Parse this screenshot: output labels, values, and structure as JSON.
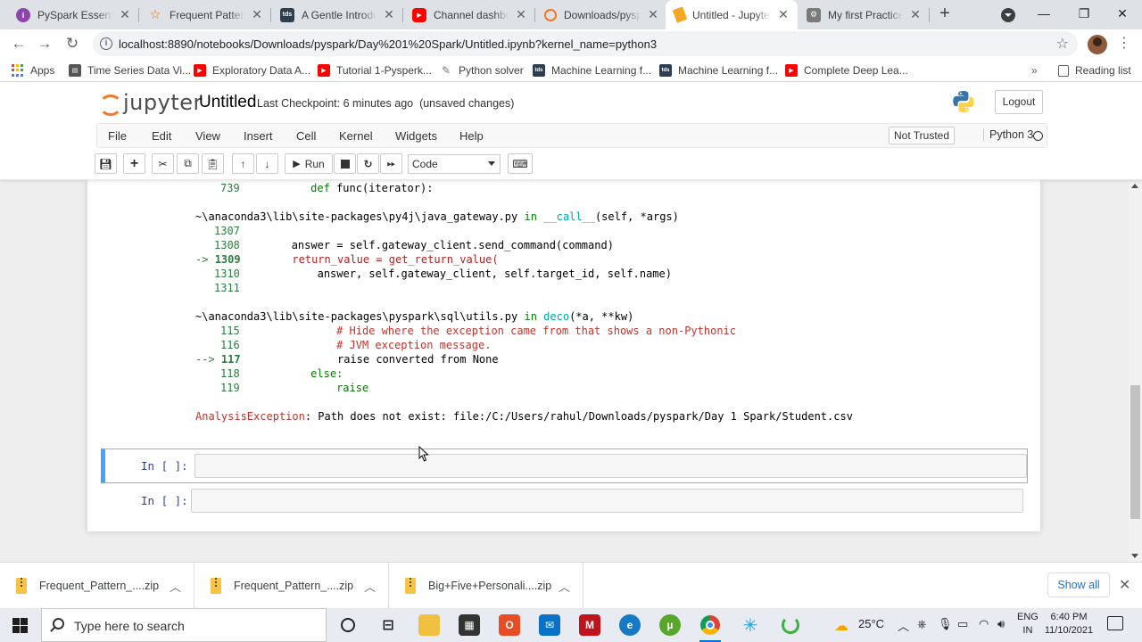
{
  "browser": {
    "tabs": [
      {
        "title": "PySpark Essentials",
        "icon": "pyspark-favicon",
        "color": "#8e44ad",
        "active": false
      },
      {
        "title": "Frequent Pattern Mining",
        "icon": "star-favicon",
        "color": "#e8710a",
        "active": false
      },
      {
        "title": "A Gentle Introduction",
        "icon": "tds-favicon",
        "color": "#2c3e50",
        "active": false
      },
      {
        "title": "Channel dashboard",
        "icon": "youtube-favicon",
        "color": "#ff0000",
        "active": false
      },
      {
        "title": "Downloads/pyspark",
        "icon": "jupyter-favicon",
        "color": "#f37726",
        "active": false
      },
      {
        "title": "Untitled - Jupyter",
        "icon": "jupyter-notebook-favicon",
        "color": "#f37726",
        "active": true
      },
      {
        "title": "My first Practice",
        "icon": "practice-favicon",
        "color": "#7b7b7b",
        "active": false
      }
    ],
    "url": "localhost:8890/notebooks/Downloads/pyspark/Day%201%20Spark/Untitled.ipynb?kernel_name=python3",
    "bookmarks": [
      {
        "label": "Apps",
        "icon": "apps-grid-icon"
      },
      {
        "label": "Time Series Data Vi...",
        "icon": "bookmark-favicon"
      },
      {
        "label": "Exploratory Data A...",
        "icon": "youtube-favicon"
      },
      {
        "label": "Tutorial 1-Pysperk...",
        "icon": "youtube-favicon"
      },
      {
        "label": "Python solver",
        "icon": "python-favicon"
      },
      {
        "label": "Machine Learning f...",
        "icon": "tds-favicon"
      },
      {
        "label": "Machine Learning f...",
        "icon": "tds-favicon"
      },
      {
        "label": "Complete Deep Lea...",
        "icon": "youtube-favicon"
      }
    ],
    "reading_list": "Reading list"
  },
  "jupyter": {
    "logo_text": "jupyter",
    "notebook_name": "Untitled",
    "checkpoint": "Last Checkpoint: 6 minutes ago",
    "unsaved": "(unsaved changes)",
    "logout": "Logout",
    "menu": [
      "File",
      "Edit",
      "View",
      "Insert",
      "Cell",
      "Kernel",
      "Widgets",
      "Help"
    ],
    "trusted": "Not Trusted",
    "kernel": "Python 3",
    "run_label": "Run",
    "cell_type": "Code"
  },
  "traceback": {
    "line_739_num": "739",
    "line_739_code": "def func(iterator):",
    "frame1_path": "~\\anaconda3\\lib\\site-packages\\py4j\\java_gateway.py",
    "frame1_in": "in",
    "frame1_func": "__call__",
    "frame1_args": "(self, *args)",
    "f1_lines": [
      {
        "num": "1307",
        "code": ""
      },
      {
        "num": "1308",
        "code": "answer = self.gateway_client.send_command(command)"
      },
      {
        "num": "1309",
        "code": "return_value = get_return_value("
      },
      {
        "num": "1310",
        "code": "answer, self.gateway_client, self.target_id, self.name)"
      },
      {
        "num": "1311",
        "code": ""
      }
    ],
    "frame2_path": "~\\anaconda3\\lib\\site-packages\\pyspark\\sql\\utils.py",
    "frame2_in": "in",
    "frame2_func": "deco",
    "frame2_args": "(*a, **kw)",
    "f2_lines": [
      {
        "num": "115",
        "code": "# Hide where the exception came from that shows a non-Pythonic"
      },
      {
        "num": "116",
        "code": "# JVM exception message."
      },
      {
        "num": "117",
        "code": "raise converted from None"
      },
      {
        "num": "118",
        "code": "else:"
      },
      {
        "num": "119",
        "code": "raise"
      }
    ],
    "arrow1": "->",
    "arrow2": "-->",
    "exception_type": "AnalysisException",
    "exception_msg": ": Path does not exist: file:/C:/Users/rahul/Downloads/pyspark/Day 1 Spark/Student.csv"
  },
  "cells": [
    {
      "prompt": "In [ ]:"
    },
    {
      "prompt": "In [ ]:"
    }
  ],
  "downloads": {
    "items": [
      "Frequent_Pattern_....zip",
      "Frequent_Pattern_....zip",
      "Big+Five+Personali....zip"
    ],
    "show_all": "Show all"
  },
  "taskbar": {
    "search_placeholder": "Type here to search",
    "temperature": "25°C",
    "lang_line1": "ENG",
    "lang_line2": "IN",
    "time": "6:40 PM",
    "date": "11/10/2021"
  }
}
